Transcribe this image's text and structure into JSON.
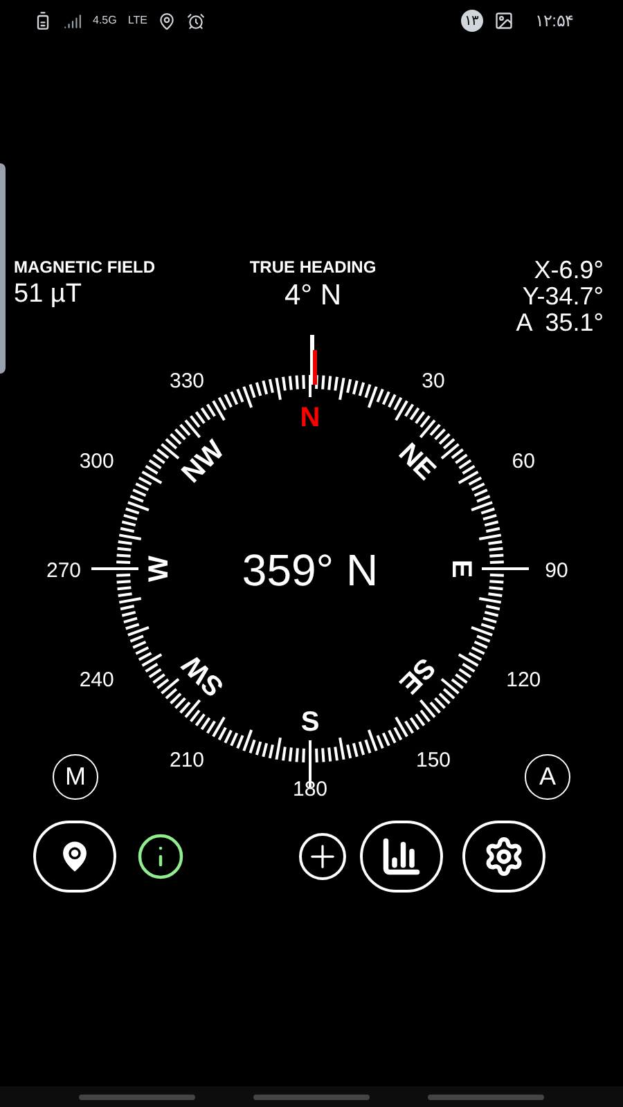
{
  "status_bar": {
    "network": [
      "4.5G",
      "LTE"
    ],
    "badge": "۱۳",
    "time": "۱۲:۵۴"
  },
  "readings": {
    "magnetic_field": {
      "label": "MAGNETIC FIELD",
      "value": "51 µT"
    },
    "true_heading": {
      "label": "TRUE HEADING",
      "value": "4° N"
    },
    "tilt": [
      "X-6.9°",
      "Y-34.7°",
      "A  35.1°"
    ]
  },
  "compass": {
    "heading": "359° N",
    "cardinals": [
      {
        "text": "N",
        "color": "#ff0000"
      },
      {
        "text": "NE",
        "color": "#ffffff"
      },
      {
        "text": "E",
        "color": "#ffffff"
      },
      {
        "text": "SE",
        "color": "#ffffff"
      },
      {
        "text": "S",
        "color": "#ffffff"
      },
      {
        "text": "SW",
        "color": "#ffffff"
      },
      {
        "text": "W",
        "color": "#ffffff"
      },
      {
        "text": "NW",
        "color": "#ffffff"
      }
    ],
    "degrees": [
      "30",
      "60",
      "90",
      "120",
      "150",
      "180",
      "210",
      "240",
      "270",
      "300",
      "330"
    ]
  },
  "modes": [
    "M",
    "A"
  ],
  "toolbar": [
    {
      "kind": "location",
      "active": false
    },
    {
      "kind": "info",
      "active": true
    },
    {
      "kind": "add",
      "active": false
    },
    {
      "kind": "stats",
      "active": false
    },
    {
      "kind": "settings",
      "active": false
    }
  ]
}
